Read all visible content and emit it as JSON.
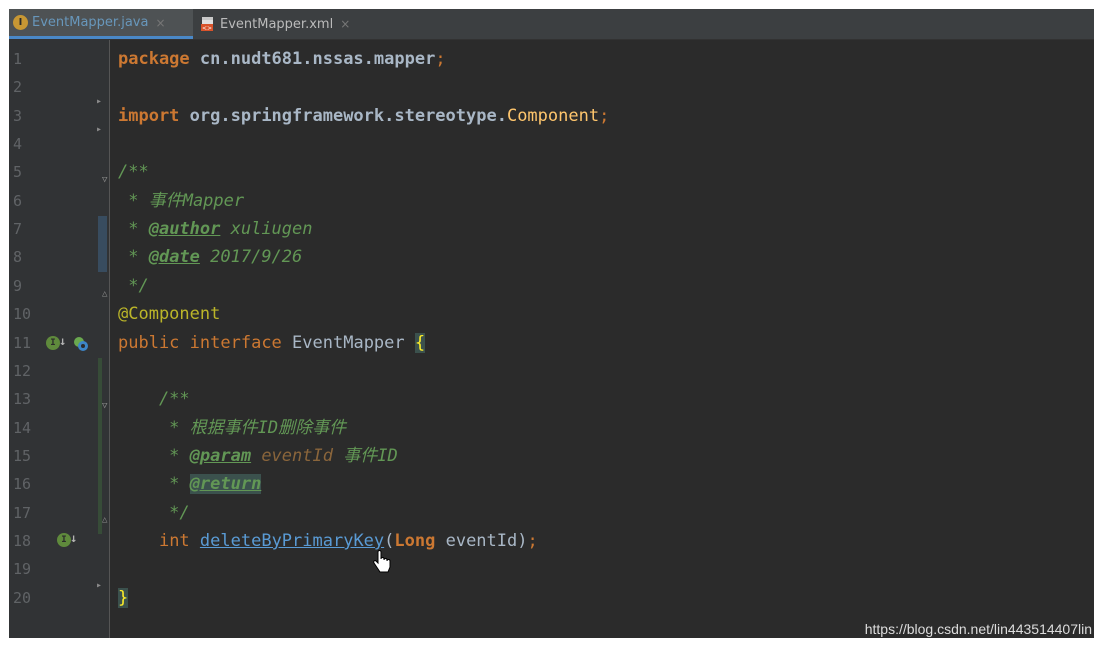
{
  "tabs": [
    {
      "label": "EventMapper.java",
      "active": true,
      "icon": "java-interface-icon",
      "close": "×"
    },
    {
      "label": "EventMapper.xml",
      "active": false,
      "icon": "xml-file-icon",
      "close": "×"
    }
  ],
  "lines": [
    "1",
    "2",
    "3",
    "4",
    "5",
    "6",
    "7",
    "8",
    "9",
    "10",
    "11",
    "12",
    "13",
    "14",
    "15",
    "16",
    "17",
    "18",
    "19",
    "20"
  ],
  "code": {
    "l1_kw": "package",
    "l1_pkg": "cn.nudt681.nssas.mapper",
    "l1_semi": ";",
    "l3_kw": "import",
    "l3_pkg": "org.springframework.stereotype.",
    "l3_cls": "Component",
    "l3_semi": ";",
    "l5": "/**",
    "l6": " * 事件Mapper",
    "l7_star": " * ",
    "l7_tag": "@author",
    "l7_rest": " xuliugen",
    "l8_star": " * ",
    "l8_tag": "@date",
    "l8_rest": " 2017/9/26",
    "l9": " */",
    "l10": "@Component",
    "l11_kw1": "public",
    "l11_kw2": "interface",
    "l11_name": "EventMapper",
    "l11_brace": "{",
    "l13": "    /**",
    "l14": "     * 根据事件ID删除事件",
    "l15_star": "     * ",
    "l15_tag": "@param",
    "l15_param": " eventId",
    "l15_rest": " 事件ID",
    "l16_star": "     * ",
    "l16_tag": "@return",
    "l17": "     */",
    "l18_indent": "    ",
    "l18_kw": "int",
    "l18_method": "deleteByPrimaryKey",
    "l18_open": "(",
    "l18_type": "Long",
    "l18_arg": " eventId",
    "l18_close": ")",
    "l18_semi": ";",
    "l20_brace": "}"
  },
  "colors": {
    "editor_bg": "#2b2b2b",
    "gutter_bg": "#313335",
    "keyword": "#cc7832",
    "comment": "#629755",
    "annotation": "#bbb529",
    "class": "#ffc66d",
    "method_link": "#5a9bd5",
    "brace_highlight": "#ffef28"
  },
  "watermark": "https://blog.csdn.net/lin443514407lin"
}
